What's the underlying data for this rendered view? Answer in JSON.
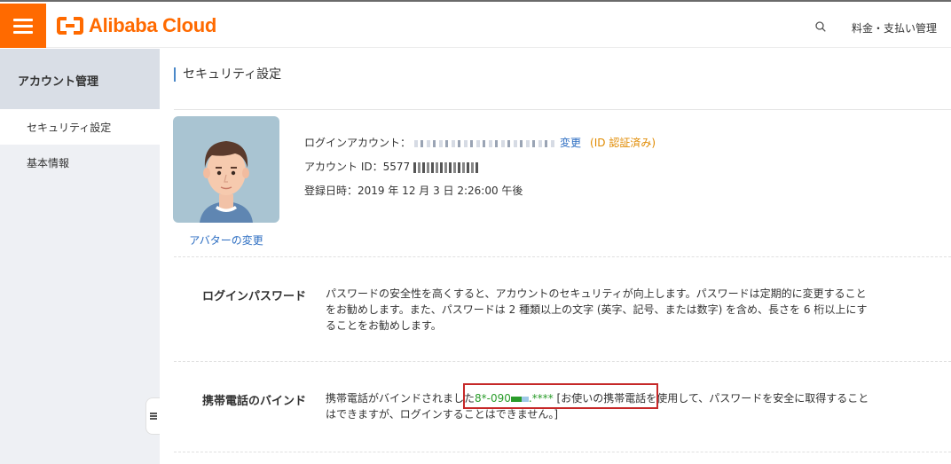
{
  "header": {
    "logo_text": "Alibaba Cloud",
    "search_icon": "search-icon",
    "billing_label": "料金・支払い管理"
  },
  "sidebar": {
    "title": "アカウント管理",
    "items": [
      {
        "label": "セキュリティ設定",
        "active": true
      },
      {
        "label": "基本情報",
        "active": false
      }
    ]
  },
  "main": {
    "title": "セキュリティ設定",
    "profile": {
      "avatar_change_label": "アバターの変更",
      "login_account_label": "ログインアカウント：",
      "change_label": "変更",
      "verify_open": "(",
      "verify_label": "ID 認証済み",
      "verify_close": ")",
      "account_id_label": "アカウント ID：",
      "account_id_value": "5577",
      "registered_label": "登録日時：",
      "registered_value": "2019 年 12 月 3 日 2:26:00 午後"
    },
    "password": {
      "label": "ログインパスワード",
      "text": "パスワードの安全性を高くすると、アカウントのセキュリティが向上します。パスワードは定期的に変更することをお勧めします。また、パスワードは 2 種類以上の文字 (英字、記号、または数字) を含め、長さを 6 桁以上にすることをお勧めします。"
    },
    "phone": {
      "label": "携帯電話のバインド",
      "text_before": "携帯電話がバインドされました",
      "number_prefix": "8*-090",
      "number_suffix": ".****",
      "text_after": " [お使いの携帯電話を使用して、パスワードを安全に取得することはできますが、ログインすることはできません。]"
    }
  },
  "colors": {
    "brand": "#ff6a00",
    "link": "#2d6ec2",
    "verified": "#e08a00",
    "phone": "#2a9c2a",
    "highlight": "#c62828"
  }
}
